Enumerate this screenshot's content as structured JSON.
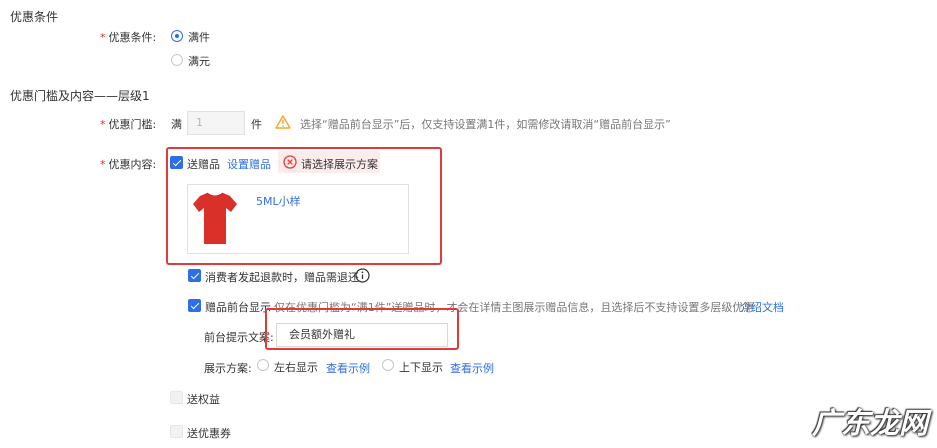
{
  "section1": {
    "title": "优惠条件",
    "condition_label": "优惠条件:",
    "options": [
      {
        "label": "满件",
        "selected": true
      },
      {
        "label": "满元",
        "selected": false
      }
    ]
  },
  "section2": {
    "title": "优惠门槛及内容——层级1",
    "threshold_label": "优惠门槛:",
    "threshold_prefix": "满",
    "threshold_value": "1",
    "threshold_unit": "件",
    "threshold_warning": "选择“赠品前台显示”后，仅支持设置满1件，如需修改请取消“赠品前台显示”",
    "content_label": "优惠内容:",
    "gift": {
      "checkbox_label": "送赠品",
      "checked": true,
      "set_link": "设置赠品",
      "error_text": "请选择展示方案",
      "product_name": "5ML小样",
      "product_color": "#d9302a"
    },
    "refund": {
      "label": "消费者发起退款时，赠品需退还",
      "checked": true
    },
    "frontend_display": {
      "label": "赠品前台显示",
      "checked": true,
      "note": "仅在优惠门槛为“满1件”送赠品时，才会在详情主图展示赠品信息，且选择后不支持设置多层级优惠",
      "doc_link": "介绍文档",
      "hint_label": "前台提示文案:",
      "hint_value": "会员额外赠礼",
      "scheme_label": "展示方案:",
      "schemes": [
        {
          "label": "左右显示",
          "example": "查看示例",
          "selected": false
        },
        {
          "label": "上下显示",
          "example": "查看示例",
          "selected": false
        }
      ]
    },
    "rights": {
      "label": "送权益",
      "checked": false
    },
    "coupon": {
      "label": "送优惠券",
      "checked": false
    }
  },
  "watermark": "广东龙网",
  "colors": {
    "accent": "#2e6ee6",
    "required": "#e02e24",
    "highlight": "#e23a3a",
    "warning": "#f5a623"
  }
}
